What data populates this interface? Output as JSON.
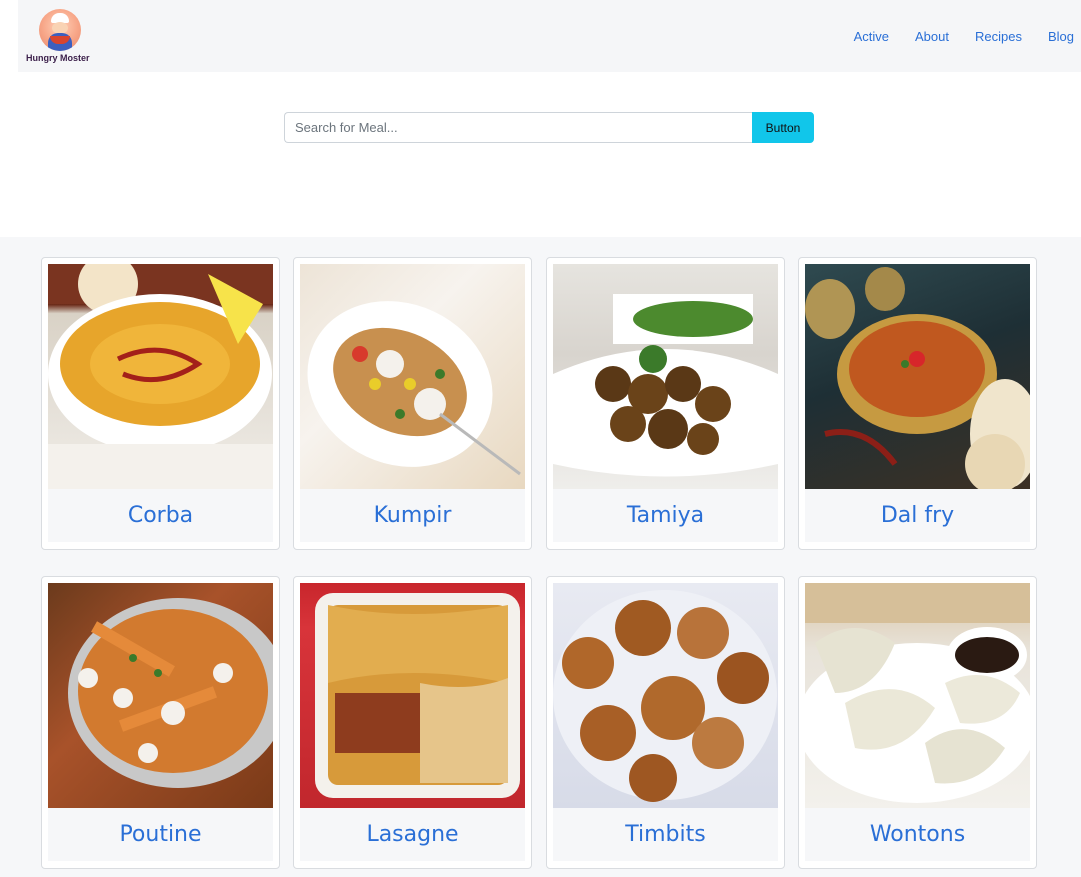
{
  "brand": {
    "name": "Hungry Moster"
  },
  "nav": {
    "links": [
      "Active",
      "About",
      "Recipes",
      "Blog"
    ]
  },
  "search": {
    "placeholder": "Search for Meal...",
    "button_label": "Button"
  },
  "meals": [
    {
      "name": "Corba"
    },
    {
      "name": "Kumpir"
    },
    {
      "name": "Tamiya"
    },
    {
      "name": "Dal fry"
    },
    {
      "name": "Poutine"
    },
    {
      "name": "Lasagne"
    },
    {
      "name": "Timbits"
    },
    {
      "name": "Wontons"
    }
  ],
  "colors": {
    "accent": "#2a6fd6",
    "button": "#11c6ea",
    "navbar_bg": "#f5f6f8",
    "section_bg": "#f6f7f9"
  }
}
